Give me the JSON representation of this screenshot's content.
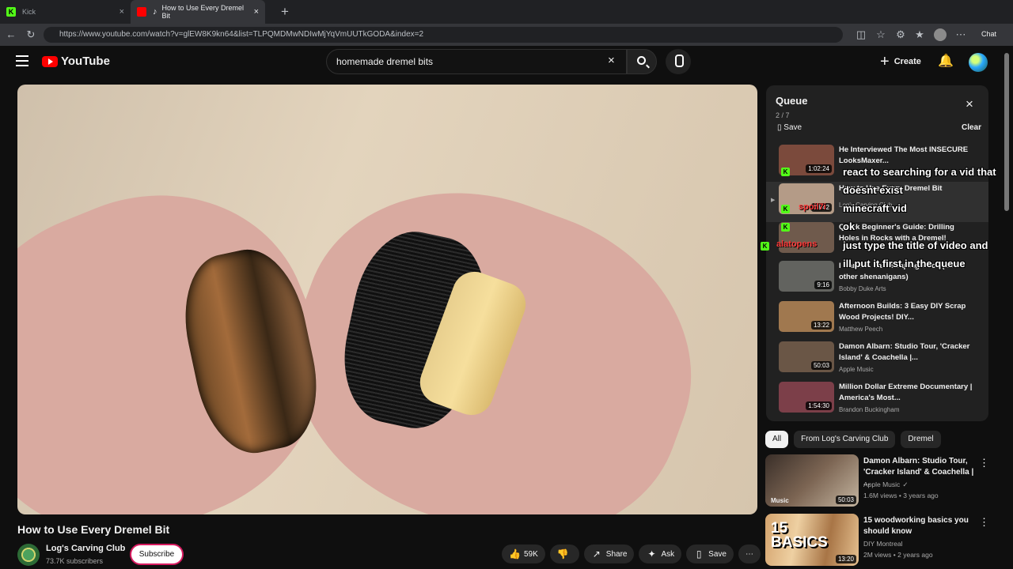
{
  "browser": {
    "tabs": [
      {
        "label": "Kick",
        "active": false
      },
      {
        "label": "How to Use Every Dremel Bit",
        "active": true
      }
    ],
    "url": "https://www.youtube.com/watch?v=glEW8K9kn64&list=TLPQMDMwNDIwMjYqVmUUTkGODA&index=2",
    "chat_label": "Chat"
  },
  "youtube": {
    "logo_text": "YouTube",
    "search_value": "homemade dremel bits",
    "create_label": "Create"
  },
  "video": {
    "title": "How to Use Every Dremel Bit",
    "channel": "Log's Carving Club",
    "subscribers": "73.7K subscribers",
    "subscribe_label": "Subscribe",
    "likes": "59K",
    "share_label": "Share",
    "ask_label": "Ask",
    "save_label": "Save"
  },
  "queue": {
    "title": "Queue",
    "position": "2 / 7",
    "save_label": "Save",
    "clear_label": "Clear",
    "items": [
      {
        "title": "He Interviewed The Most INSECURE LooksMaxer...",
        "duration": "1:02:24",
        "channel": "",
        "thumb_color": "#7b4a3c"
      },
      {
        "title": "How to Use Every Dremel Bit",
        "duration": "23:42",
        "channel": "Log's Carving Club",
        "thumb_color": "#b49b87"
      },
      {
        "title": "Quick Beginner's Guide: Drilling Holes in Rocks with a Dremel!",
        "duration": "",
        "channel": "Rotary Crafts",
        "thumb_color": "#6f5a4c"
      },
      {
        "title": "I Carve A Landscaping Rock (and other shenanigans)",
        "duration": "9:16",
        "channel": "Bobby Duke Arts",
        "thumb_color": "#62635f"
      },
      {
        "title": "Afternoon Builds: 3 Easy DIY Scrap Wood Projects! DIY...",
        "duration": "13:22",
        "channel": "Matthew Peech",
        "thumb_color": "#a0784f"
      },
      {
        "title": "Damon Albarn: Studio Tour, 'Cracker Island' & Coachella |...",
        "duration": "50:03",
        "channel": "Apple Music",
        "thumb_color": "#6a5646"
      },
      {
        "title": "Million Dollar Extreme Documentary | America's Most...",
        "duration": "1:54:30",
        "channel": "Brandon Buckingham",
        "thumb_color": "#7c3f49"
      }
    ]
  },
  "chat_overlay": [
    {
      "user": "",
      "message": "react to searching for a vid that"
    },
    {
      "user": "",
      "message": "doesnt exist"
    },
    {
      "user": "spoil7i",
      "message": "minecraft vid"
    },
    {
      "user": "",
      "message": "ok"
    },
    {
      "user": "alatopens",
      "message": "just type the title of video and"
    },
    {
      "user": "",
      "message": "ill put it first in the queue"
    }
  ],
  "chips": [
    "All",
    "From Log's Carving Club",
    "Dremel"
  ],
  "recommendations": [
    {
      "title": "Damon Albarn: Studio Tour, 'Cracker Island' & Coachella | ...",
      "channel": "Apple Music",
      "meta": "1.6M views • 3 years ago",
      "duration": "50:03",
      "thumb_label": "Music",
      "thumb_color": "#5c4a3d"
    },
    {
      "title": "15 woodworking basics you should know",
      "channel": "DIY Montreal",
      "meta": "2M views • 2 years ago",
      "duration": "13:20",
      "thumb_label": "15 BASICS",
      "thumb_color": "#b98b56"
    }
  ],
  "colors": {
    "background": "#0f0f0f",
    "youtube_red": "#ff0000",
    "kick_green": "#53fc18",
    "subscribe_border": "#d81b60"
  },
  "icons": [
    "search-icon",
    "microphone-icon",
    "bell-icon",
    "like-icon",
    "dislike-icon",
    "share-icon",
    "sparkle-icon",
    "bookmark-icon",
    "close-icon",
    "more-icon"
  ]
}
